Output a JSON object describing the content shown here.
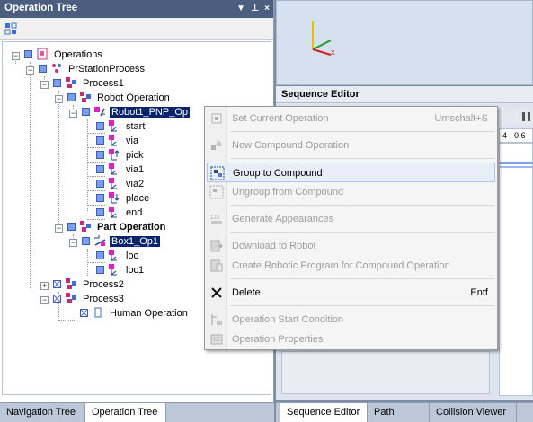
{
  "left_panel": {
    "title": "Operation Tree",
    "controls": [
      "▼",
      "⊥",
      "×"
    ],
    "tree": [
      {
        "label": "Operations"
      },
      {
        "label": "PrStationProcess"
      },
      {
        "label": "Process1"
      },
      {
        "label": "Robot Operation"
      },
      {
        "label": "Robot1_PNP_Op",
        "selected": true
      },
      {
        "label": "start"
      },
      {
        "label": "via"
      },
      {
        "label": "pick"
      },
      {
        "label": "via1"
      },
      {
        "label": "via2"
      },
      {
        "label": "place"
      },
      {
        "label": "end"
      },
      {
        "label": "Part Operation"
      },
      {
        "label": "Box1_Op1",
        "selected": true
      },
      {
        "label": "loc"
      },
      {
        "label": "loc1"
      },
      {
        "label": "Process2"
      },
      {
        "label": "Process3"
      },
      {
        "label": "Human Operation"
      }
    ],
    "tabs": [
      {
        "label": "Navigation Tree",
        "active": false
      },
      {
        "label": "Operation Tree",
        "active": true
      }
    ]
  },
  "sequence_editor": {
    "title": "Sequence Editor",
    "ruler_labels": [
      "4",
      "0.6"
    ]
  },
  "right_tabs": [
    {
      "label": "Sequence Editor"
    },
    {
      "label": "Path Editor"
    },
    {
      "label": "Collision Viewer"
    }
  ],
  "context_menu": {
    "items": [
      {
        "label": "Set Current Operation",
        "shortcut": "Umschalt+S",
        "enabled": false,
        "icon": "set-current-icon"
      },
      {
        "label": "New Compound Operation",
        "shortcut": "",
        "enabled": false,
        "icon": "new-compound-icon"
      },
      {
        "label": "Group to Compound",
        "shortcut": "",
        "enabled": true,
        "highlighted": true,
        "icon": "group-compound-icon"
      },
      {
        "label": "Ungroup from Compound",
        "shortcut": "",
        "enabled": false,
        "icon": "ungroup-compound-icon"
      },
      {
        "label": "Generate Appearances",
        "shortcut": "",
        "enabled": false,
        "icon": "generate-appearances-icon"
      },
      {
        "label": "Download to Robot",
        "shortcut": "",
        "enabled": false,
        "icon": "download-robot-icon"
      },
      {
        "label": "Create Robotic Program for Compound Operation",
        "shortcut": "",
        "enabled": false,
        "icon": "create-program-icon"
      },
      {
        "label": "Delete",
        "shortcut": "Entf",
        "enabled": true,
        "icon": "delete-icon"
      },
      {
        "label": "Operation Start Condition",
        "shortcut": "",
        "enabled": false,
        "icon": "start-condition-icon"
      },
      {
        "label": "Operation Properties",
        "shortcut": "",
        "enabled": false,
        "icon": "properties-icon"
      }
    ]
  },
  "colors": {
    "titlebar": "#4b5e7f",
    "selection": "#0a246a",
    "menu_highlight": "#e8eef8"
  }
}
